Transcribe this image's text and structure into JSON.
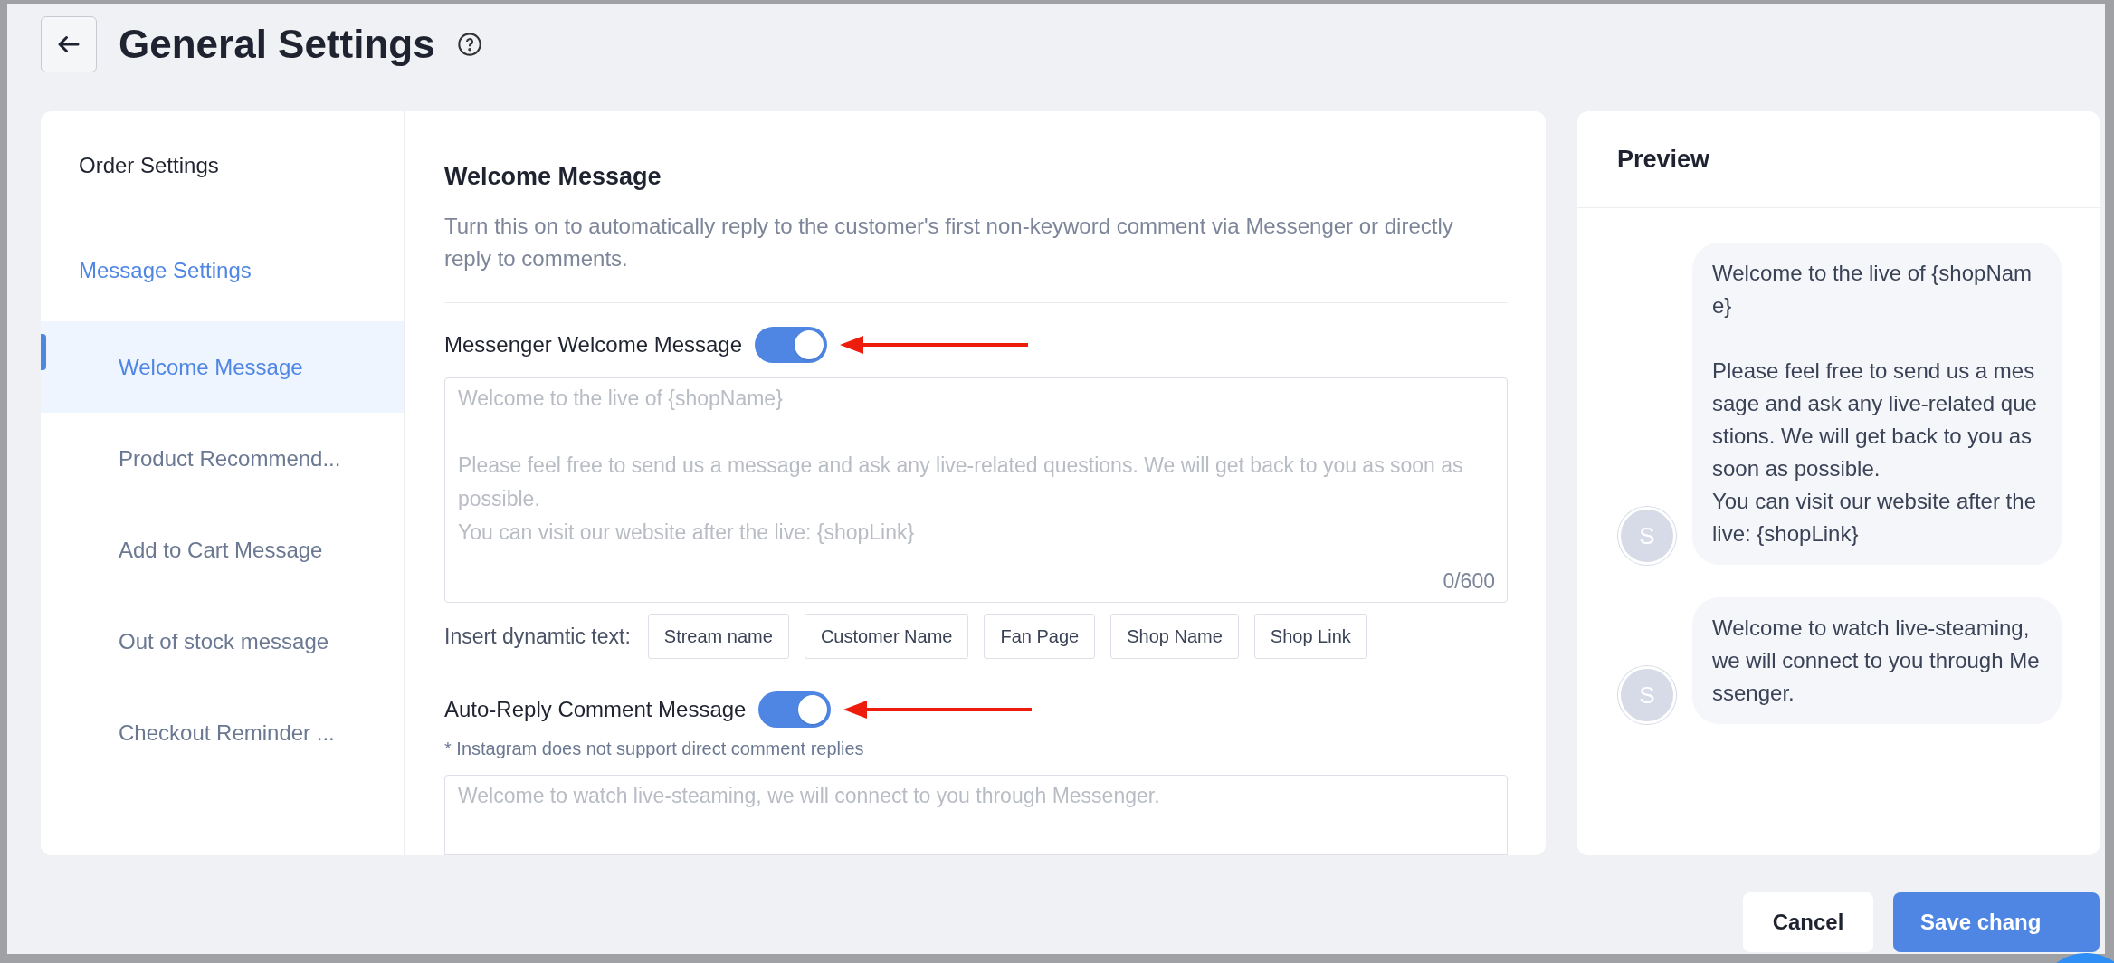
{
  "header": {
    "title": "General Settings"
  },
  "sidebar": {
    "items": [
      {
        "label": "Order Settings",
        "kind": "section",
        "selected": false
      },
      {
        "label": "Message Settings",
        "kind": "section",
        "selected": true
      },
      {
        "label": "Welcome Message",
        "kind": "item",
        "selected": true
      },
      {
        "label": "Product Recommend...",
        "kind": "item",
        "selected": false
      },
      {
        "label": "Add to Cart Message",
        "kind": "item",
        "selected": false
      },
      {
        "label": "Out of stock message",
        "kind": "item",
        "selected": false
      },
      {
        "label": "Checkout Reminder ...",
        "kind": "item",
        "selected": false
      }
    ]
  },
  "content": {
    "title": "Welcome Message",
    "description": "Turn this on to automatically reply to the customer's first non-keyword comment via Messenger or directly reply to comments.",
    "messenger": {
      "label": "Messenger Welcome Message",
      "on": true,
      "placeholder": "Welcome to the live of {shopName}\n\nPlease feel free to send us a message and ask any live-related questions. We will get back to you as soon as possible.\nYou can visit our website after the live: {shopLink}",
      "counter": "0/600"
    },
    "insert_label": "Insert dynamtic text:",
    "insert_buttons": [
      "Stream name",
      "Customer Name",
      "Fan Page",
      "Shop Name",
      "Shop Link"
    ],
    "comment": {
      "label": "Auto-Reply Comment Message",
      "on": true,
      "note": "* Instagram does not support direct comment replies",
      "placeholder": "Welcome to watch live-steaming, we will connect to you through Messenger."
    }
  },
  "preview": {
    "title": "Preview",
    "messages": [
      {
        "avatar": "S",
        "text": "Welcome to the live of {shopName}\n\nPlease feel free to send us a message and ask any live-related questions. We will get back to you as soon as possible.\nYou can visit our website after the live: {shopLink}"
      },
      {
        "avatar": "S",
        "text": "Welcome to watch live-steaming, we will connect to you through Messenger."
      }
    ]
  },
  "footer": {
    "buttons": [
      {
        "label": "Cancel",
        "kind": "secondary"
      },
      {
        "label": "Save chang",
        "kind": "primary"
      }
    ]
  }
}
